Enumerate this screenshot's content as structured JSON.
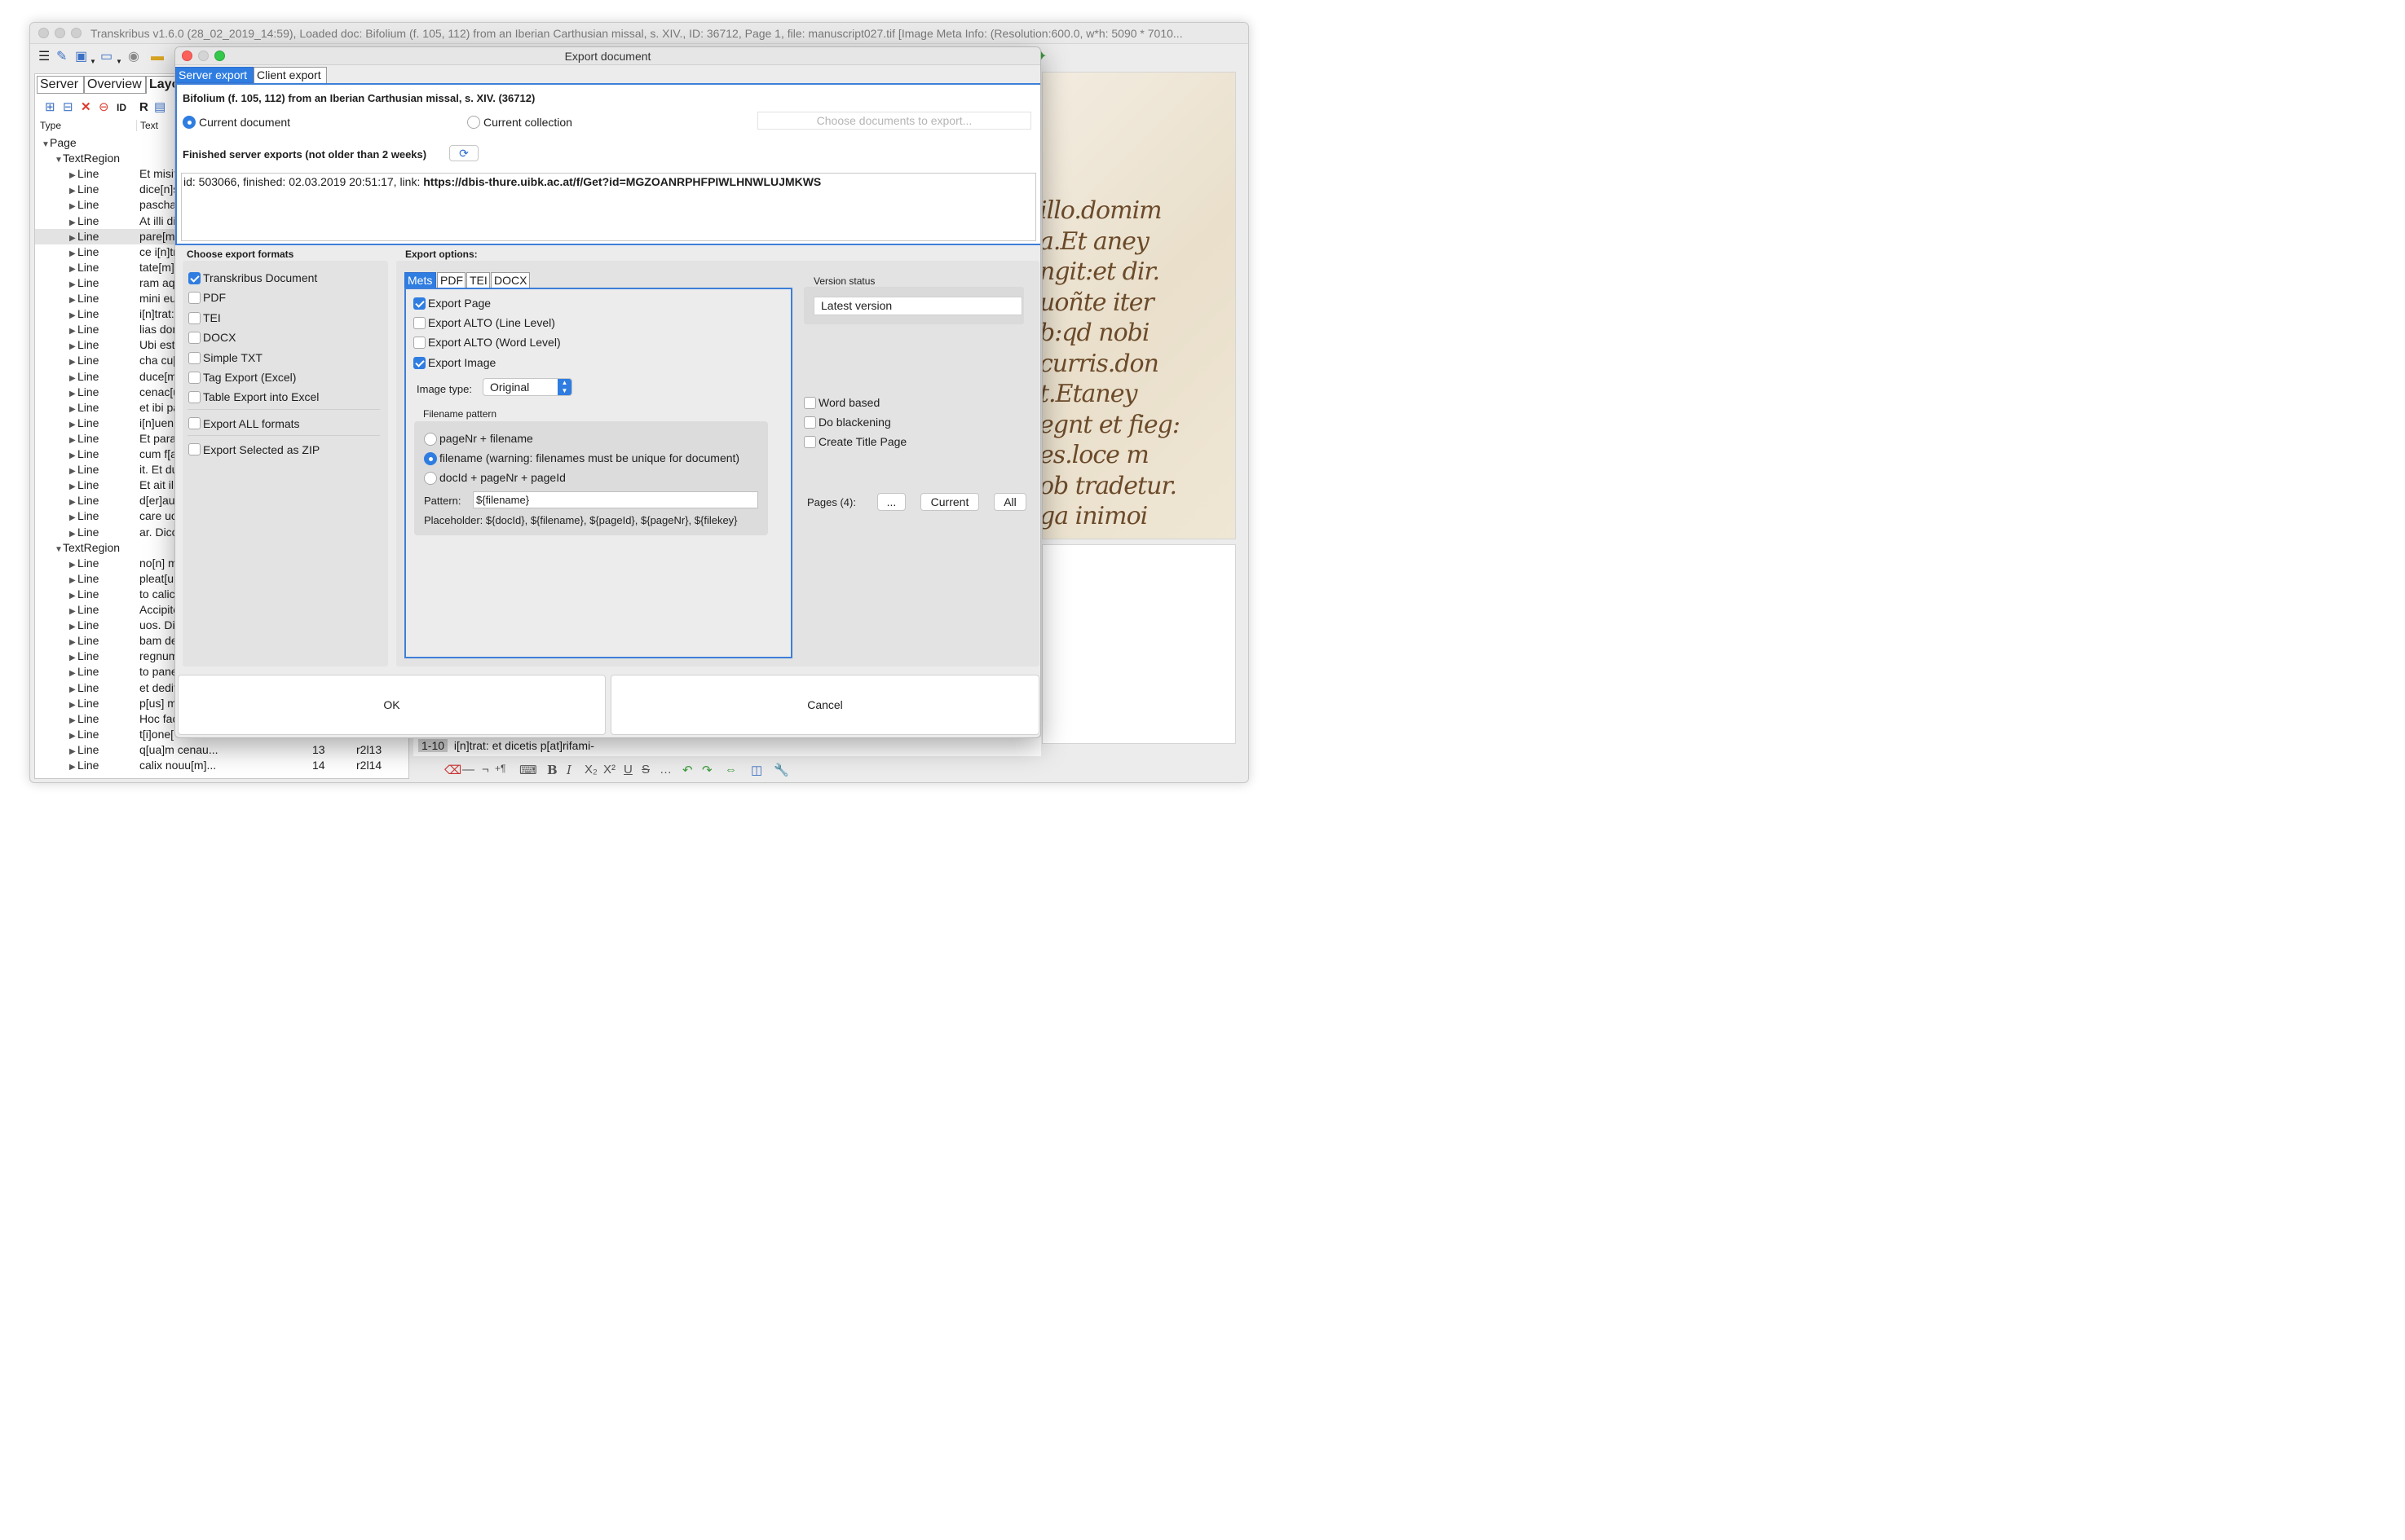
{
  "main_window": {
    "title": "Transkribus v1.6.0 (28_02_2019_14:59), Loaded doc: Bifolium (f. 105, 112) from an Iberian Carthusian missal, s. XIV., ID: 36712, Page 1, file: manuscript027.tif [Image Meta Info: (Resolution:600.0, w*h: 5090 * 7010..."
  },
  "left_panel": {
    "tabs": [
      "Server",
      "Overview",
      "Layo"
    ],
    "columns": {
      "type": "Type",
      "text": "Text"
    },
    "tree": [
      {
        "type": "Page",
        "text": "",
        "level": 0,
        "kind": "page"
      },
      {
        "type": "TextRegion",
        "text": "",
        "level": 1,
        "kind": "region"
      },
      {
        "type": "Line",
        "text": "Et misit",
        "level": 2
      },
      {
        "type": "Line",
        "text": "dice[n]s",
        "level": 2
      },
      {
        "type": "Line",
        "text": "pascha.",
        "level": 2
      },
      {
        "type": "Line",
        "text": "At illi di",
        "level": 2
      },
      {
        "type": "Line",
        "text": "pare[mu",
        "level": 2,
        "selected": true
      },
      {
        "type": "Line",
        "text": "ce i[n]tr",
        "level": 2
      },
      {
        "type": "Line",
        "text": "tate[m]",
        "level": 2
      },
      {
        "type": "Line",
        "text": "ram aqu",
        "level": 2
      },
      {
        "type": "Line",
        "text": "mini eu",
        "level": 2
      },
      {
        "type": "Line",
        "text": "i[n]trat:",
        "level": 2
      },
      {
        "type": "Line",
        "text": "lias don",
        "level": 2
      },
      {
        "type": "Line",
        "text": "Ubi est",
        "level": 2
      },
      {
        "type": "Line",
        "text": "cha cu[",
        "level": 2
      },
      {
        "type": "Line",
        "text": "duce[m",
        "level": 2
      },
      {
        "type": "Line",
        "text": "cenac[u",
        "level": 2
      },
      {
        "type": "Line",
        "text": "et ibi pa",
        "level": 2
      },
      {
        "type": "Line",
        "text": "i[n]uen",
        "level": 2
      },
      {
        "type": "Line",
        "text": "Et parau",
        "level": 2
      },
      {
        "type": "Line",
        "text": "cum f[a",
        "level": 2
      },
      {
        "type": "Line",
        "text": "it. Et du",
        "level": 2
      },
      {
        "type": "Line",
        "text": "Et ait illi",
        "level": 2
      },
      {
        "type": "Line",
        "text": "d[er]au",
        "level": 2
      },
      {
        "type": "Line",
        "text": "care uo",
        "level": 2
      },
      {
        "type": "Line",
        "text": "ar. Dico",
        "level": 2
      },
      {
        "type": "TextRegion",
        "text": "",
        "level": 1,
        "kind": "region"
      },
      {
        "type": "Line",
        "text": "no[n] m",
        "level": 2
      },
      {
        "type": "Line",
        "text": "pleat[ur",
        "level": 2
      },
      {
        "type": "Line",
        "text": "to calic",
        "level": 2
      },
      {
        "type": "Line",
        "text": "Accipite",
        "level": 2
      },
      {
        "type": "Line",
        "text": "uos. Dic",
        "level": 2
      },
      {
        "type": "Line",
        "text": "bam de",
        "level": 2
      },
      {
        "type": "Line",
        "text": "regnum",
        "level": 2
      },
      {
        "type": "Line",
        "text": "to pane",
        "level": 2
      },
      {
        "type": "Line",
        "text": "et dedit",
        "level": 2
      },
      {
        "type": "Line",
        "text": "p[us] m",
        "level": 2
      },
      {
        "type": "Line",
        "text": "Hoc fac",
        "level": 2
      },
      {
        "type": "Line",
        "text": "t[i]one[",
        "level": 2
      },
      {
        "type": "Line",
        "text": "q[ua]m cenau...",
        "level": 2,
        "num": "13",
        "id": "r2l13"
      },
      {
        "type": "Line",
        "text": "calix nouu[m]...",
        "level": 2,
        "num": "14",
        "id": "r2l14"
      }
    ]
  },
  "manuscript_lines": [
    "illo.domim",
    "a.Et aney",
    "ngit:et dir.",
    "uoñte iter",
    "b:qd nobi",
    "curris.don",
    "t.Etaney",
    "egnt et fieg:",
    "es.loce m",
    "ob tradetur.",
    "ga inimoi"
  ],
  "bottom_line": {
    "label": "1-10",
    "text": "i[n]trat: et dicetis p[at]rifami-"
  },
  "dialog": {
    "title": "Export document",
    "tabs": [
      "Server export",
      "Client export"
    ],
    "doc_title": "Bifolium (f. 105, 112) from an Iberian Carthusian missal, s. XIV. (36712)",
    "scope": {
      "current_document": "Current document",
      "current_collection": "Current collection",
      "choose_docs": "Choose documents to export..."
    },
    "finished_label": "Finished server exports (not older than 2 weeks)",
    "export_entry": {
      "prefix": "id: 503066, finished: 02.03.2019 20:51:17, link: ",
      "link": "https://dbis-thure.uibk.ac.at/f/Get?id=MGZOANRPHFPIWLHNWLUJMKWS"
    },
    "formats": {
      "heading": "Choose export formats",
      "items": [
        {
          "label": "Transkribus Document",
          "checked": true
        },
        {
          "label": "PDF",
          "checked": false
        },
        {
          "label": "TEI",
          "checked": false
        },
        {
          "label": "DOCX",
          "checked": false
        },
        {
          "label": "Simple TXT",
          "checked": false
        },
        {
          "label": "Tag Export (Excel)",
          "checked": false
        },
        {
          "label": "Table Export into Excel",
          "checked": false
        }
      ],
      "export_all": "Export ALL formats",
      "export_zip": "Export Selected as ZIP"
    },
    "options": {
      "heading": "Export options:",
      "tabs": [
        "Mets",
        "PDF",
        "TEI",
        "DOCX"
      ],
      "mets": {
        "export_page": "Export Page",
        "alto_line": "Export ALTO (Line Level)",
        "alto_word": "Export ALTO (Word Level)",
        "export_image": "Export Image",
        "image_type_label": "Image type:",
        "image_type_value": "Original",
        "filename_pattern_title": "Filename pattern",
        "patterns": [
          "pageNr + filename",
          "filename (warning: filenames must be unique for document)",
          "docId + pageNr + pageId"
        ],
        "pattern_label": "Pattern:",
        "pattern_value": "${filename}",
        "placeholder_text": "Placeholder: ${docId}, ${filename}, ${pageId}, ${pageNr}, ${filekey}"
      },
      "version_status_label": "Version status",
      "version_value": "Latest version",
      "word_based": "Word based",
      "do_blackening": "Do blackening",
      "create_title_page": "Create Title Page",
      "pages_label": "Pages (4):",
      "pages_more": "...",
      "pages_current": "Current",
      "pages_all": "All"
    },
    "ok": "OK",
    "cancel": "Cancel"
  },
  "colors": {
    "accent": "#2f7de1",
    "selection": "#3d7fd9",
    "close": "#fc605b",
    "minimize": "#fdbc40",
    "maximize": "#34c84a"
  }
}
